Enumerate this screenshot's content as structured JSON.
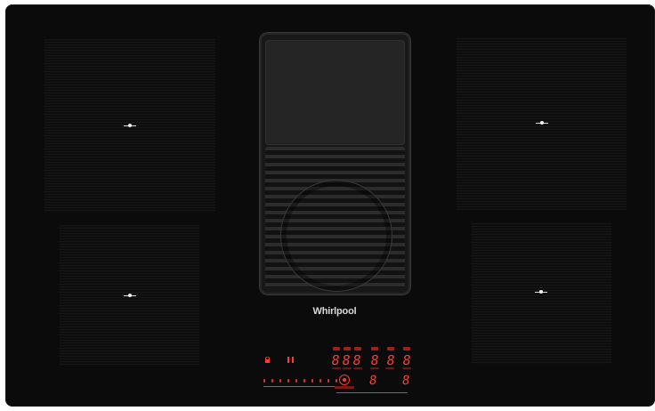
{
  "appliance": {
    "brand": "Whirlpool",
    "body_color": "#0b0b0b",
    "accent_color": "#ff3b30"
  },
  "zones": [
    {
      "name": "rear-left",
      "indicator": "zone-marker"
    },
    {
      "name": "front-left",
      "indicator": "zone-marker"
    },
    {
      "name": "rear-right",
      "indicator": "zone-marker"
    },
    {
      "name": "front-right",
      "indicator": "zone-marker"
    }
  ],
  "vent": {
    "icon": "extractor-grille-icon"
  },
  "controls": {
    "lock_icon": "lock-icon",
    "pause_icon": "pause-icon",
    "hood_icon": "fan-button-icon",
    "top_digits": [
      "8",
      "8",
      "8",
      "8",
      "8",
      "8"
    ],
    "bottom_digits": [
      "8",
      "8"
    ],
    "slider_steps": 10
  }
}
